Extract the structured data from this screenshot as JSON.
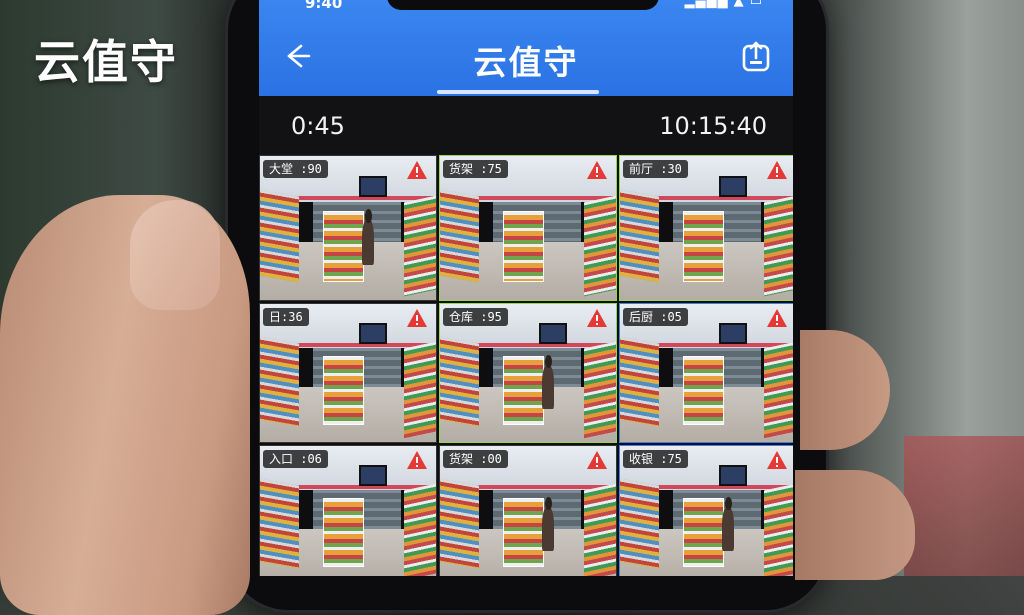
{
  "overlay": {
    "caption": "云值守"
  },
  "status_bar": {
    "time": "9:40",
    "icons": "▂▄▆█ ▲ ▭"
  },
  "header": {
    "title": "云值守",
    "back_icon": "back-arrow-icon",
    "share_icon": "share-icon"
  },
  "timebar": {
    "elapsed": "0:45",
    "clock": "10:15:40"
  },
  "accent_color": "#2b72e4",
  "alert_color": "#e53935",
  "cameras": [
    {
      "label": "大堂 :90",
      "alert": true
    },
    {
      "label": "货架 :75",
      "alert": true
    },
    {
      "label": "前厅 :30",
      "alert": true
    },
    {
      "label": "日:36",
      "alert": true
    },
    {
      "label": "仓库 :95",
      "alert": true
    },
    {
      "label": "后厨 :05",
      "alert": true
    },
    {
      "label": "入口 :06",
      "alert": true
    },
    {
      "label": "货架 :00",
      "alert": true
    },
    {
      "label": "收银 :75",
      "alert": true
    }
  ]
}
